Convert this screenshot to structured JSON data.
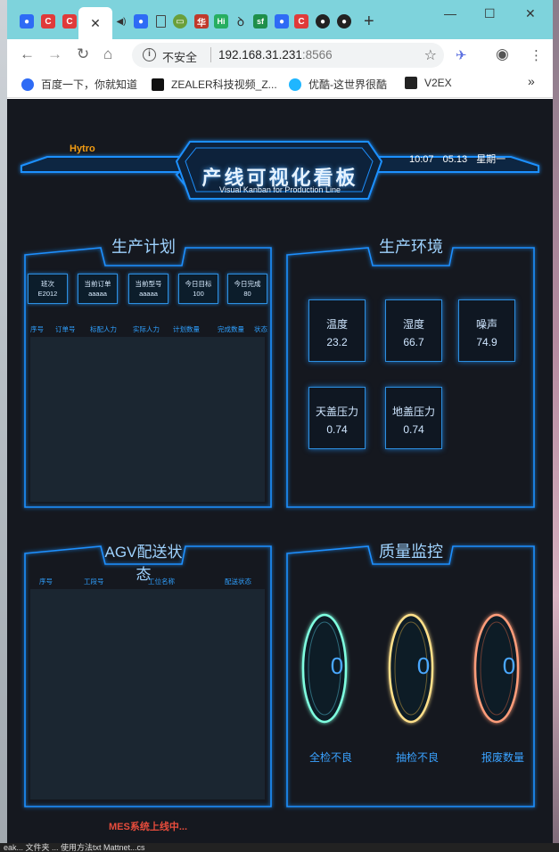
{
  "desktop": {
    "taskbar_text": "eak... 文件夹 ... 使用方法txt  Mattnet...cs"
  },
  "browser": {
    "tabs": [
      {
        "icon": "baidu-paw-icon",
        "color": "#2e6bf5"
      },
      {
        "icon": "c-red-icon",
        "color": "#e03a3a",
        "glyph": "C"
      },
      {
        "icon": "c-red-icon",
        "color": "#e03a3a",
        "glyph": "C"
      },
      {
        "icon": "close-icon",
        "active": true,
        "glyph": "✕"
      },
      {
        "icon": "speaker-icon",
        "glyph": "🔊"
      },
      {
        "icon": "baidu-paw-icon",
        "color": "#2e6bf5"
      },
      {
        "icon": "document-icon",
        "glyph": "🗋"
      },
      {
        "icon": "gamepad-icon",
        "color": "#6a9f3a"
      },
      {
        "icon": "huapai-icon",
        "color": "#c0392b",
        "glyph": "华"
      },
      {
        "icon": "hi-icon",
        "color": "#27ae60",
        "glyph": "Hi"
      },
      {
        "icon": "spiral-icon",
        "color": "#333",
        "glyph": "ꝺ"
      },
      {
        "icon": "sf-icon",
        "color": "#1f8f4a",
        "glyph": "sf"
      },
      {
        "icon": "baidu-paw-icon",
        "color": "#2e6bf5"
      },
      {
        "icon": "c-red-icon",
        "color": "#e03a3a",
        "glyph": "C"
      },
      {
        "icon": "github-icon",
        "color": "#222"
      },
      {
        "icon": "github-icon",
        "color": "#222"
      }
    ],
    "new_tab_glyph": "+",
    "window": {
      "minimize": "—",
      "maximize": "☐",
      "close": "✕"
    },
    "address": {
      "insecure_label": "不安全",
      "host": "192.168.31.231",
      "port": ":8566"
    },
    "bookmarks": [
      {
        "label": "百度一下，你就知道",
        "icon": "baidu-paw-icon",
        "color": "#2e6bf5"
      },
      {
        "label": "ZEALER科技视频_Z...",
        "icon": "zealer-icon",
        "color": "#111"
      },
      {
        "label": "优酷-这世界很酷",
        "icon": "youku-icon",
        "color": "#1fb6ff"
      },
      {
        "label": "V2EX",
        "icon": "v2ex-icon",
        "color": "#222"
      }
    ],
    "more_bookmarks": "»"
  },
  "dashboard": {
    "logo": "Hytro",
    "title": "产线可视化看板",
    "subtitle": "Visual Kanban for Production Line",
    "clock": {
      "time": "10:07",
      "date": "05.13",
      "weekday": "星期一"
    },
    "plan": {
      "title": "生产计划",
      "stats": [
        {
          "label": "班次",
          "value": "E2012"
        },
        {
          "label": "当前订单",
          "value": "aaaaa"
        },
        {
          "label": "当前型号",
          "value": "aaaaa"
        },
        {
          "label": "今日目标",
          "value": "100"
        },
        {
          "label": "今日完成",
          "value": "80"
        }
      ],
      "columns": [
        "序号",
        "订单号",
        "标配人力",
        "实际人力",
        "计划数量",
        "完成数量",
        "状态"
      ]
    },
    "env": {
      "title": "生产环境",
      "items": [
        {
          "label": "温度",
          "value": "23.2"
        },
        {
          "label": "湿度",
          "value": "66.7"
        },
        {
          "label": "噪声",
          "value": "74.9"
        },
        {
          "label": "天盖压力",
          "value": "0.74"
        },
        {
          "label": "地盖压力",
          "value": "0.74"
        }
      ]
    },
    "agv": {
      "title": "AGV配送状态",
      "columns": [
        "序号",
        "工段号",
        "工位名称",
        "配送状态"
      ]
    },
    "quality": {
      "title": "质量监控",
      "items": [
        {
          "label": "全检不良",
          "value": "0",
          "color": "#7fffe0"
        },
        {
          "label": "抽检不良",
          "value": "0",
          "color": "#ffe08a"
        },
        {
          "label": "报废数量",
          "value": "0",
          "color": "#ff9d7a"
        }
      ]
    },
    "status_text": "MES系统上线中..."
  }
}
